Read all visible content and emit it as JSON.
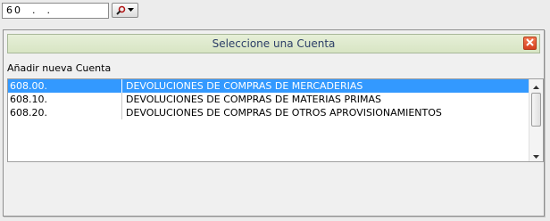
{
  "account_field": {
    "value": "60  .  ."
  },
  "search_button": {
    "icon": "search-icon",
    "dropdown_icon": "dropdown-arrow-icon"
  },
  "dialog": {
    "title": "Seleccione una Cuenta",
    "close_icon": "close-icon",
    "add_link": "Añadir nueva Cuenta"
  },
  "accounts": [
    {
      "code": "608.00.",
      "description": "DEVOLUCIONES DE COMPRAS DE MERCADERIAS",
      "selected": true
    },
    {
      "code": "608.10.",
      "description": "DEVOLUCIONES DE COMPRAS DE MATERIAS PRIMAS",
      "selected": false
    },
    {
      "code": "608.20.",
      "description": "DEVOLUCIONES DE COMPRAS DE OTROS APROVISIONAMIENTOS",
      "selected": false
    }
  ],
  "colors": {
    "selection": "#3399ff",
    "title_bar": "#dfe9cf",
    "title_text": "#2a3d66",
    "close_button": "#e2542e"
  }
}
